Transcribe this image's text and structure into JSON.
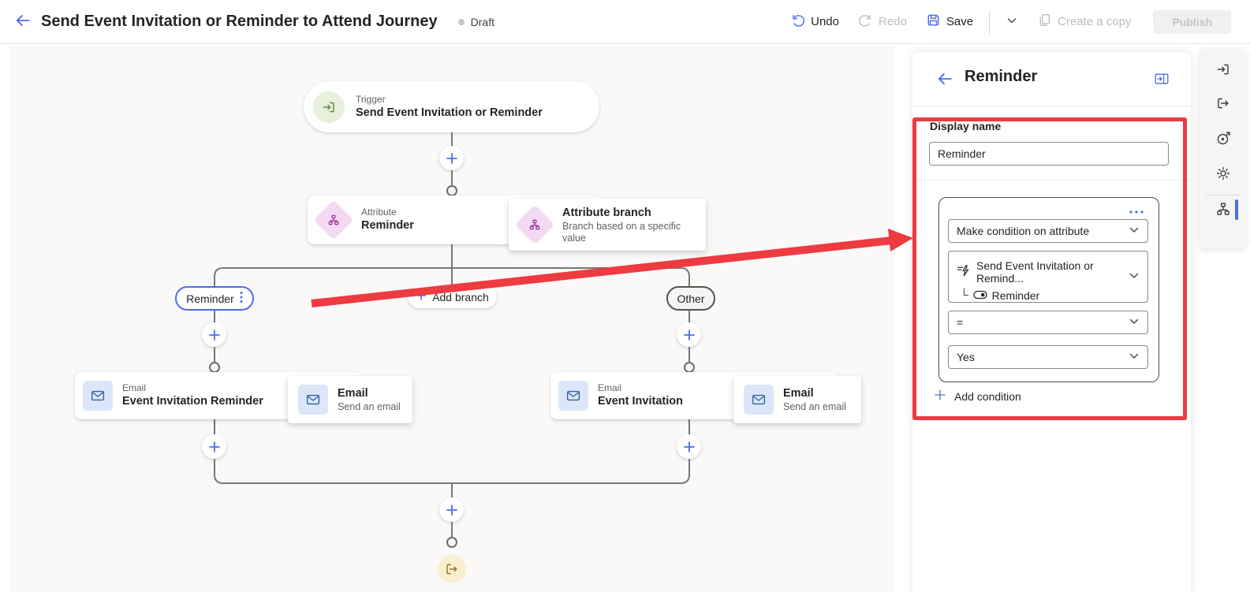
{
  "colors": {
    "accent": "#4f6bed",
    "annotation_red": "#ee3a41",
    "canvas_bg": "#faf9f7"
  },
  "header": {
    "title": "Send Event Invitation or Reminder to Attend Journey",
    "status": "Draft",
    "undo": "Undo",
    "redo": "Redo",
    "save": "Save",
    "create_copy": "Create a copy",
    "publish": "Publish"
  },
  "canvas": {
    "trigger": {
      "kind": "Trigger",
      "title": "Send Event Invitation or Reminder"
    },
    "attribute": {
      "kind": "Attribute",
      "title": "Reminder"
    },
    "attribute_tooltip": {
      "title": "Attribute branch",
      "subtitle": "Branch based on a specific value"
    },
    "branch_left": "Reminder",
    "branch_add": "Add branch",
    "branch_right": "Other",
    "email_left": {
      "kind": "Email",
      "title": "Event Invitation Reminder"
    },
    "email_left_tooltip": {
      "title": "Email",
      "subtitle": "Send an email"
    },
    "email_right": {
      "kind": "Email",
      "title": "Event Invitation"
    },
    "email_right_tooltip": {
      "title": "Email",
      "subtitle": "Send an email"
    }
  },
  "panel": {
    "title": "Reminder",
    "display_name_label": "Display name",
    "display_name_value": "Reminder",
    "condition_type": "Make condition on attribute",
    "condition_attribute": "Send Event Invitation or Remind...",
    "condition_attribute_child": "Reminder",
    "condition_operator": "=",
    "condition_value": "Yes",
    "add_condition": "Add condition"
  }
}
